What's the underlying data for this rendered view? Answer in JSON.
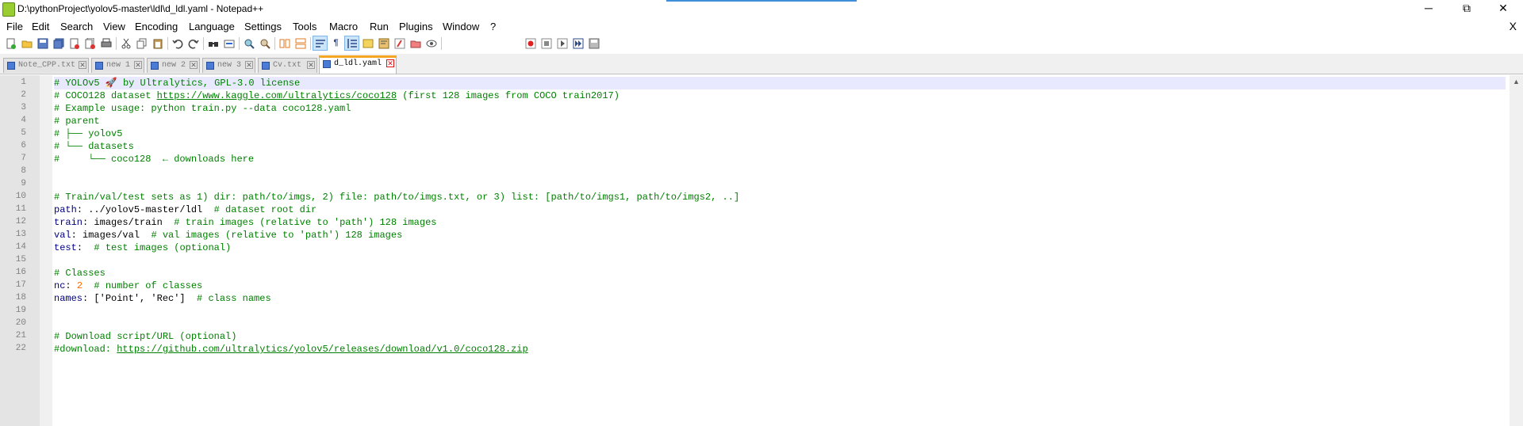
{
  "window": {
    "title": "D:\\pythonProject\\yolov5-master\\ldl\\d_ldl.yaml - Notepad++",
    "minimize": "─",
    "maximize": "⧉",
    "close": "✕"
  },
  "menu": {
    "items": [
      "File",
      "Edit",
      "Search",
      "View",
      "Encoding",
      "Language",
      "Settings",
      "Tools",
      "Macro",
      "Run",
      "Plugins",
      "Window",
      "?"
    ],
    "close_doc": "X"
  },
  "toolbar": {
    "icons": [
      "new-file-icon",
      "open-file-icon",
      "save-icon",
      "save-all-icon",
      "close-icon",
      "close-all-icon",
      "print-icon",
      "cut-icon",
      "copy-icon",
      "paste-icon",
      "undo-icon",
      "redo-icon",
      "find-icon",
      "replace-icon",
      "zoom-in-icon",
      "zoom-out-icon",
      "sync-vertical-icon",
      "sync-horizontal-icon",
      "word-wrap-icon",
      "show-all-chars-icon",
      "indent-guide-icon",
      "udl-icon",
      "doc-map-icon",
      "function-list-icon",
      "folder-workspace-icon",
      "monitoring-icon",
      "record-macro-icon",
      "stop-record-icon",
      "play-macro-icon",
      "run-macro-multiple-icon",
      "save-macro-icon"
    ]
  },
  "tabs": [
    {
      "label": "Note_CPP.txt",
      "active": false
    },
    {
      "label": "new 1",
      "active": false
    },
    {
      "label": "new 2",
      "active": false
    },
    {
      "label": "new 3",
      "active": false
    },
    {
      "label": "Cv.txt",
      "active": false
    },
    {
      "label": "d_ldl.yaml",
      "active": true
    }
  ],
  "editor": {
    "current_line": 1,
    "lines": [
      {
        "n": "1",
        "segs": [
          {
            "t": "# YOLOv5 🚀 by Ultralytics, GPL-3.0 license",
            "c": "c"
          }
        ]
      },
      {
        "n": "2",
        "segs": [
          {
            "t": "# COCO128 dataset ",
            "c": "c"
          },
          {
            "t": "https://www.kaggle.com/ultralytics/coco128",
            "c": "cu"
          },
          {
            "t": " (first 128 images from COCO train2017)",
            "c": "c"
          }
        ]
      },
      {
        "n": "3",
        "segs": [
          {
            "t": "# Example usage: python train.py --data coco128.yaml",
            "c": "c"
          }
        ]
      },
      {
        "n": "4",
        "segs": [
          {
            "t": "# parent",
            "c": "c"
          }
        ]
      },
      {
        "n": "5",
        "segs": [
          {
            "t": "# ├── yolov5",
            "c": "c"
          }
        ]
      },
      {
        "n": "6",
        "segs": [
          {
            "t": "# └── datasets",
            "c": "c"
          }
        ]
      },
      {
        "n": "7",
        "segs": [
          {
            "t": "#     └── coco128  ← downloads here",
            "c": "c"
          }
        ]
      },
      {
        "n": "8",
        "segs": []
      },
      {
        "n": "9",
        "segs": []
      },
      {
        "n": "10",
        "segs": [
          {
            "t": "# Train/val/test sets as 1) dir: path/to/imgs, 2) file: path/to/imgs.txt, or 3) list: [path/to/imgs1, path/to/imgs2, ..]",
            "c": "c"
          }
        ]
      },
      {
        "n": "11",
        "segs": [
          {
            "t": "path",
            "c": "k"
          },
          {
            "t": ": ../yolov5-master/ldl  ",
            "c": ""
          },
          {
            "t": "# dataset root dir",
            "c": "c"
          }
        ]
      },
      {
        "n": "12",
        "segs": [
          {
            "t": "train",
            "c": "k"
          },
          {
            "t": ": images/train  ",
            "c": ""
          },
          {
            "t": "# train images (relative to 'path') 128 images",
            "c": "c"
          }
        ]
      },
      {
        "n": "13",
        "segs": [
          {
            "t": "val",
            "c": "k"
          },
          {
            "t": ": images/val  ",
            "c": ""
          },
          {
            "t": "# val images (relative to 'path') 128 images",
            "c": "c"
          }
        ]
      },
      {
        "n": "14",
        "segs": [
          {
            "t": "test",
            "c": "k"
          },
          {
            "t": ":  ",
            "c": ""
          },
          {
            "t": "# test images (optional)",
            "c": "c"
          }
        ]
      },
      {
        "n": "15",
        "segs": []
      },
      {
        "n": "16",
        "segs": [
          {
            "t": "# Classes",
            "c": "c"
          }
        ]
      },
      {
        "n": "17",
        "segs": [
          {
            "t": "nc",
            "c": "k"
          },
          {
            "t": ": ",
            "c": ""
          },
          {
            "t": "2",
            "c": "n"
          },
          {
            "t": "  ",
            "c": ""
          },
          {
            "t": "# number of classes",
            "c": "c"
          }
        ]
      },
      {
        "n": "18",
        "segs": [
          {
            "t": "names",
            "c": "k"
          },
          {
            "t": ": ['Point', 'Rec']  ",
            "c": ""
          },
          {
            "t": "# class names",
            "c": "c"
          }
        ]
      },
      {
        "n": "19",
        "segs": []
      },
      {
        "n": "20",
        "segs": []
      },
      {
        "n": "21",
        "segs": [
          {
            "t": "# Download script/URL (optional)",
            "c": "c"
          }
        ]
      },
      {
        "n": "22",
        "segs": [
          {
            "t": "#download: ",
            "c": "c"
          },
          {
            "t": "https://github.com/ultralytics/yolov5/releases/download/v1.0/coco128.zip",
            "c": "cu"
          }
        ]
      }
    ]
  },
  "scrollbar": {
    "up": "▲"
  }
}
